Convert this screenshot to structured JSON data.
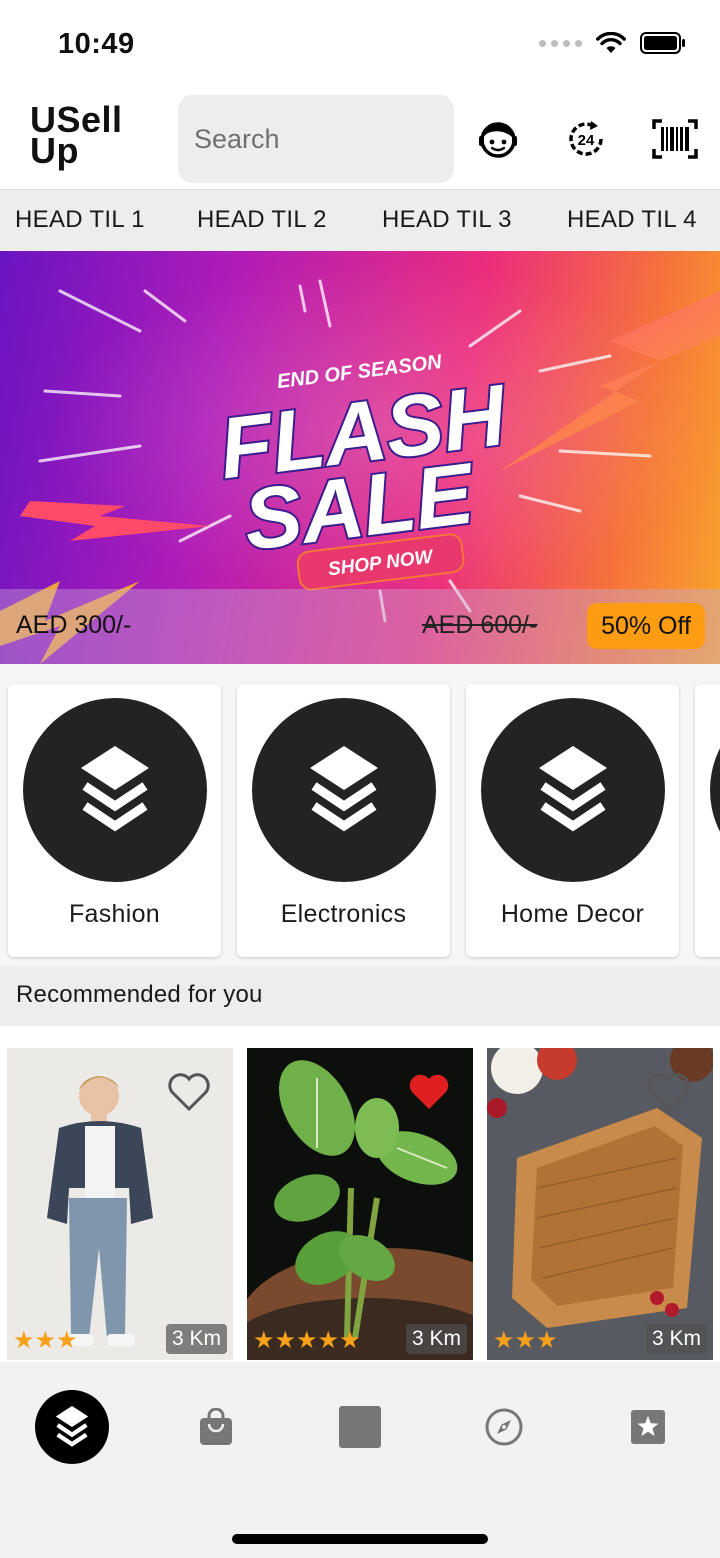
{
  "status_bar": {
    "time": "10:49"
  },
  "header": {
    "logo": "USell\nUp",
    "search_placeholder": "Search",
    "icons": [
      "support-agent-icon",
      "24-hour-service-icon",
      "barcode-scanner-icon"
    ]
  },
  "head_tiles": [
    "HEAD TIL 1",
    "HEAD TIL 2",
    "HEAD TIL 3",
    "HEAD TIL 4"
  ],
  "banner": {
    "kicker": "END OF SEASON",
    "line1": "FLASH",
    "line2": "SALE",
    "cta": "SHOP NOW",
    "price_now": "AED 300/-",
    "price_old": "AED 600/-",
    "discount": "50% Off"
  },
  "categories": [
    {
      "label": "Fashion",
      "icon": "layers-icon"
    },
    {
      "label": "Electronics",
      "icon": "layers-icon"
    },
    {
      "label": "Home Decor",
      "icon": "layers-icon"
    }
  ],
  "recommended": {
    "title": "Recommended for you",
    "items": [
      {
        "image": "boy-in-denim-jacket",
        "favorite": false,
        "rating": 3,
        "stars": "★★★",
        "distance": "3 Km"
      },
      {
        "image": "plant-seedling",
        "favorite": true,
        "rating": 5,
        "stars": "★★★★★",
        "distance": "3 Km"
      },
      {
        "image": "wicker-basket",
        "favorite": false,
        "rating": 3,
        "stars": "★★★",
        "distance": "3 Km"
      }
    ]
  },
  "bottom_nav": {
    "items": [
      "layers-icon",
      "shopping-bag-icon",
      "square-icon",
      "compass-icon",
      "star-box-icon"
    ],
    "active_index": 0
  },
  "colors": {
    "discount_badge": "#fb9c12",
    "star": "#f7a11a",
    "favorite": "#e02020",
    "dark": "#232323"
  }
}
